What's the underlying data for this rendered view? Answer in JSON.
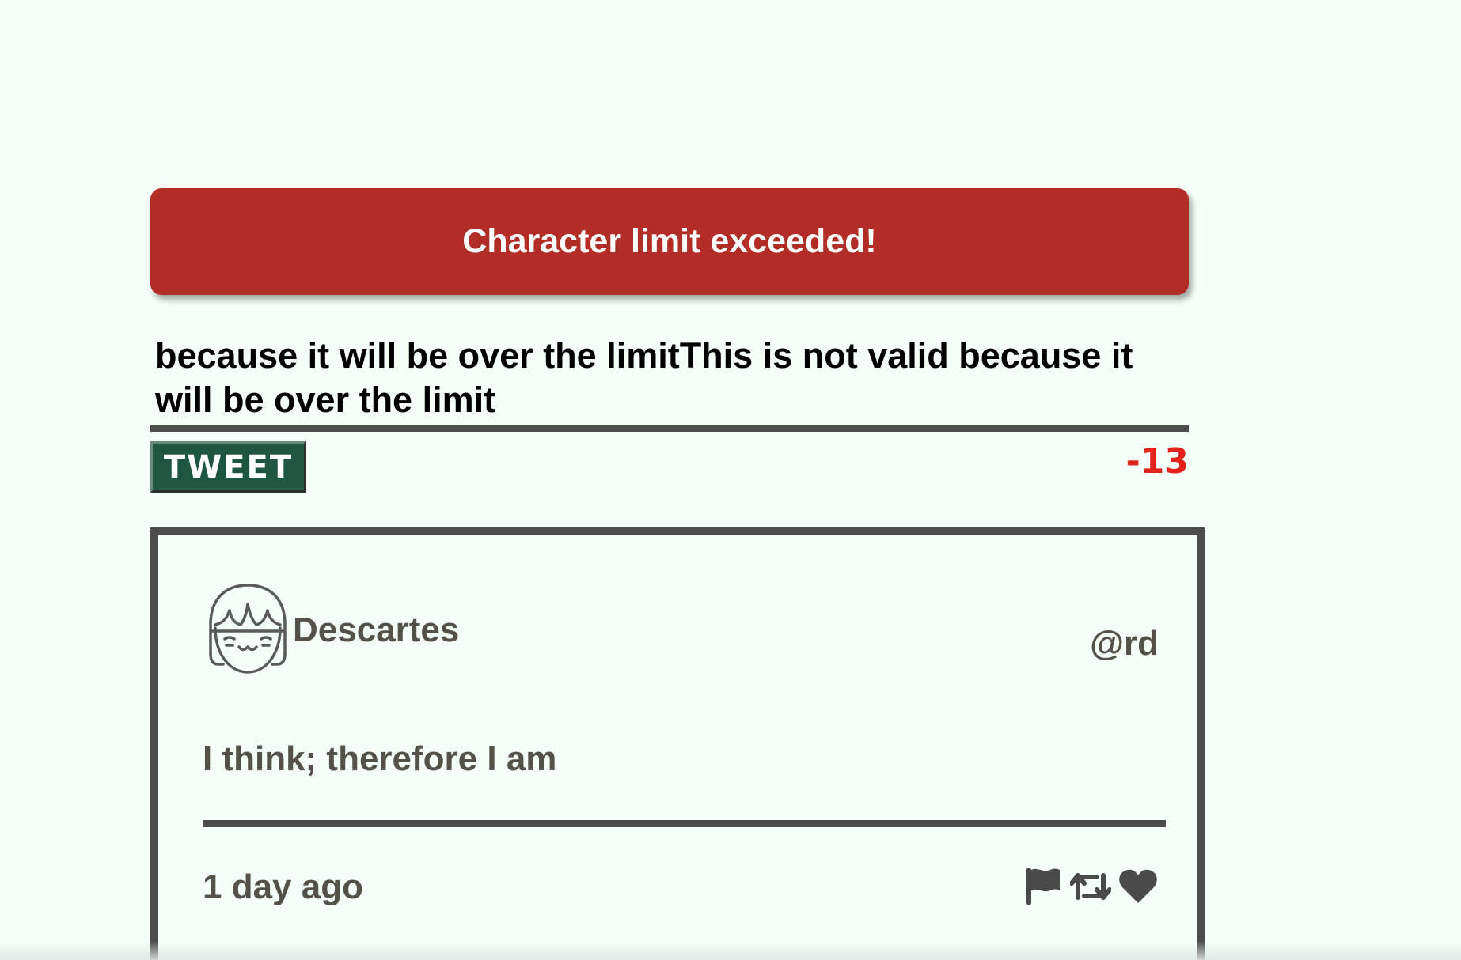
{
  "error": {
    "message": "Character limit exceeded!",
    "color": "#b32d27"
  },
  "compose": {
    "text": "because it will be over the limitThis is not valid because it will be over the limit",
    "tweet_label": "TWEET",
    "counter": "-13",
    "counter_color": "#e3231b",
    "button_color": "#1f5641"
  },
  "tweet": {
    "avatar": "girl-face-icon",
    "author_name": "Descartes",
    "handle": "@rd",
    "content": "I think; therefore I am",
    "timestamp": "1 day ago",
    "actions": [
      {
        "name": "flag-icon"
      },
      {
        "name": "retweet-icon"
      },
      {
        "name": "heart-icon"
      }
    ]
  },
  "colors": {
    "background": "#f4fff8",
    "text": "#545149",
    "border": "#4d4d4d"
  }
}
